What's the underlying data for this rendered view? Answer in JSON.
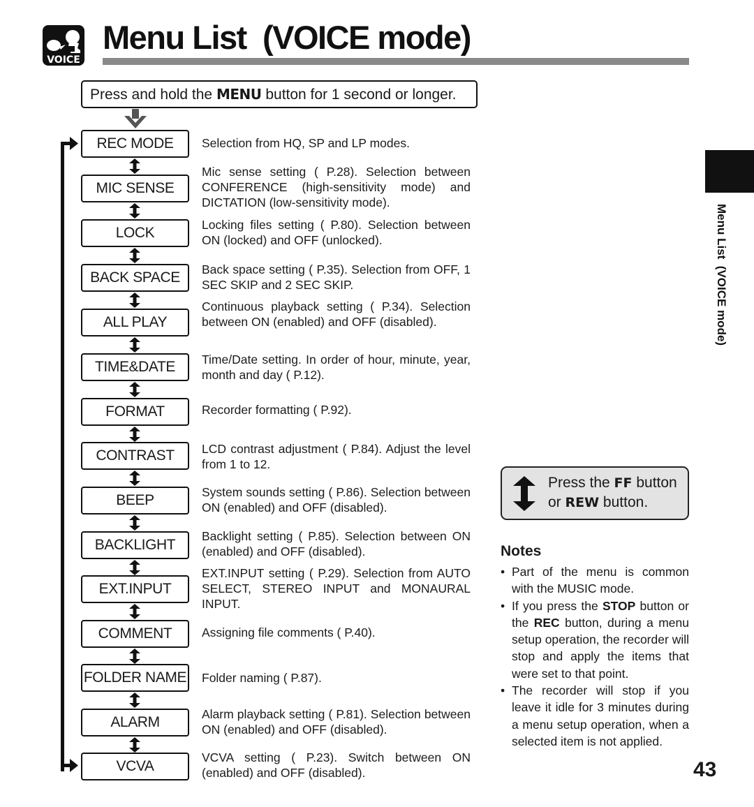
{
  "header": {
    "icon_label": "VOICE",
    "title": "Menu List  (VOICE mode)"
  },
  "instruction": {
    "before": "Press and hold the ",
    "button": "MENU",
    "after": " button for 1 second or longer."
  },
  "menu_items": [
    {
      "label": "REC MODE",
      "description": "Selection from  HQ, SP and LP modes."
    },
    {
      "label": "MIC SENSE",
      "description": "Mic sense setting (    P.28). Selection between CONFERENCE (high-sensitivity mode) and DICTATION (low-sensitivity mode)."
    },
    {
      "label": "LOCK",
      "description": "Locking files setting (    P.80). Selection between ON (locked) and OFF (unlocked)."
    },
    {
      "label": "BACK SPACE",
      "description": "Back space setting (    P.35). Selection from OFF, 1 SEC SKIP and 2 SEC SKIP."
    },
    {
      "label": "ALL PLAY",
      "description": "Continuous playback setting (    P.34). Selection between ON (enabled) and OFF (disabled)."
    },
    {
      "label": "TIME&DATE",
      "description": "Time/Date setting. In order of hour, minute, year, month and day (    P.12)."
    },
    {
      "label": "FORMAT",
      "description": "Recorder formatting (    P.92)."
    },
    {
      "label": "CONTRAST",
      "description": "LCD contrast adjustment (    P.84). Adjust the level from 1 to 12."
    },
    {
      "label": "BEEP",
      "description": "System sounds setting (    P.86). Selection between ON (enabled) and OFF (disabled)."
    },
    {
      "label": "BACKLIGHT",
      "description": "Backlight setting (    P.85). Selection between ON (enabled) and OFF (disabled)."
    },
    {
      "label": "EXT.INPUT",
      "description": "EXT.INPUT setting (    P.29). Selection from AUTO SELECT, STEREO INPUT and MONAURAL INPUT."
    },
    {
      "label": "COMMENT",
      "description": "Assigning file comments (    P.40)."
    },
    {
      "label": "FOLDER NAME",
      "description": "Folder naming (    P.87)."
    },
    {
      "label": "ALARM",
      "description": "Alarm playback setting (    P.81). Selection between ON (enabled) and OFF (disabled)."
    },
    {
      "label": "VCVA",
      "description": "VCVA setting (    P.23).  Switch between ON (enabled) and OFF (disabled)."
    }
  ],
  "side_tab": {
    "label": "Menu List  (VOICE mode)"
  },
  "hint": {
    "line1_before": "Press the ",
    "line1_button": "FF",
    "line1_after": " button",
    "line2_before": "or ",
    "line2_button": "REW",
    "line2_after": " button."
  },
  "notes": {
    "title": "Notes",
    "bullet": "•",
    "items": [
      {
        "text": "Part of the menu is common with the MUSIC mode."
      },
      {
        "parts": [
          "If you press the ",
          "STOP",
          " button or the ",
          "REC",
          " button, during a menu setup operation, the recorder will stop and apply the items that were set to that point."
        ]
      },
      {
        "text": "The recorder will stop if you leave it idle for 3 minutes during a menu setup operation, when a selected item is not applied."
      }
    ]
  },
  "page_number": "43",
  "colors": {
    "rule": "#8a8a8a",
    "hint_bg": "#e3e3e3",
    "ink": "#111111"
  }
}
